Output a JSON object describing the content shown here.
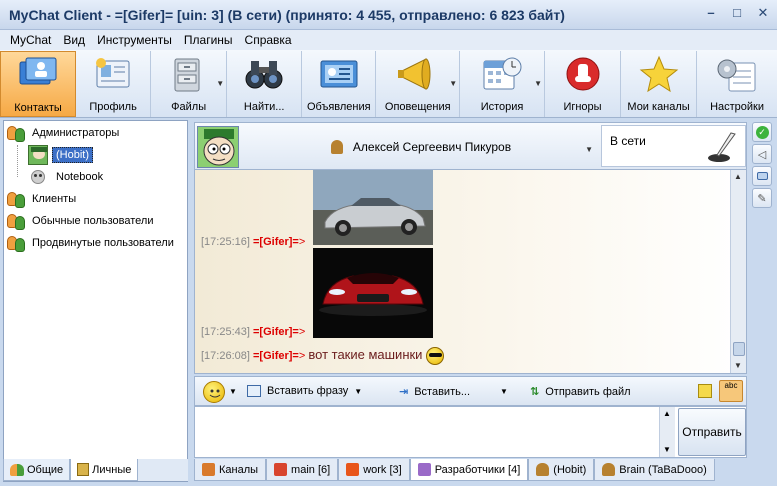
{
  "window": {
    "title": "MyChat Client - =[Gifer]= [uin: 3] (В сети) (принято: 4 455, отправлено: 6 823 байт)",
    "controls": [
      "–",
      "□",
      "✕"
    ]
  },
  "menu": [
    "MyChat",
    "Вид",
    "Инструменты",
    "Плагины",
    "Справка"
  ],
  "toolbar": [
    {
      "label": "Контакты",
      "icon": "contacts-icon",
      "active": true,
      "dropdown": false
    },
    {
      "label": "Профиль",
      "icon": "profile-icon",
      "active": false,
      "dropdown": false
    },
    {
      "label": "Файлы",
      "icon": "files-icon",
      "active": false,
      "dropdown": true
    },
    {
      "label": "Найти...",
      "icon": "binoculars-icon",
      "active": false,
      "dropdown": false
    },
    {
      "label": "Объявления",
      "icon": "announcements-icon",
      "active": false,
      "dropdown": false
    },
    {
      "label": "Оповещения",
      "icon": "megaphone-icon",
      "active": false,
      "dropdown": true
    },
    {
      "label": "История",
      "icon": "calendar-icon",
      "active": false,
      "dropdown": true
    },
    {
      "label": "Игноры",
      "icon": "stop-icon",
      "active": false,
      "dropdown": false
    },
    {
      "label": "Мои каналы",
      "icon": "star-icon",
      "active": false,
      "dropdown": false
    },
    {
      "label": "Настройки",
      "icon": "settings-icon",
      "active": false,
      "dropdown": false
    }
  ],
  "contacts": {
    "groups": [
      {
        "name": "Администраторы",
        "members": [
          "(Hobit)",
          "Notebook"
        ]
      },
      {
        "name": "Клиенты",
        "members": []
      },
      {
        "name": "Обычные пользователи",
        "members": []
      },
      {
        "name": "Продвинутые пользователи",
        "members": []
      }
    ],
    "selected": "(Hobit)",
    "tabs": [
      "Общие",
      "Личные"
    ],
    "active_tab": "Личные"
  },
  "contact_header": {
    "name": "Алексей Сергеевич Пикуров",
    "status": "В сети"
  },
  "messages": [
    {
      "time": "[17:25:16]",
      "nick": "=[Gifer]=",
      "arrow": ">",
      "text": "",
      "image": "silver-car"
    },
    {
      "time": "[17:25:43]",
      "nick": "=[Gifer]=",
      "arrow": ">",
      "text": "",
      "image": "red-car"
    },
    {
      "time": "[17:26:08]",
      "nick": "=[Gifer]=",
      "arrow": ">",
      "text": "вот такие машинки",
      "emoticon": "sunglasses-smiley"
    }
  ],
  "input_toolbar": {
    "insert_phrase": "Вставить фразу",
    "insert": "Вставить...",
    "send_file": "Отправить файл"
  },
  "send_button": "Отправить",
  "bottom_tabs": [
    {
      "label": "Каналы",
      "icon": "home-icon",
      "active": false
    },
    {
      "label": "main [6]",
      "icon": "gift-icon",
      "active": false
    },
    {
      "label": "work [3]",
      "icon": "lock-channel-icon",
      "active": false
    },
    {
      "label": "Разработчики [4]",
      "icon": "gift-icon",
      "active": true
    },
    {
      "label": "(Hobit)",
      "icon": "user-icon",
      "active": false
    },
    {
      "label": "Brain (TaBaDooo)",
      "icon": "user-icon",
      "active": false
    }
  ]
}
